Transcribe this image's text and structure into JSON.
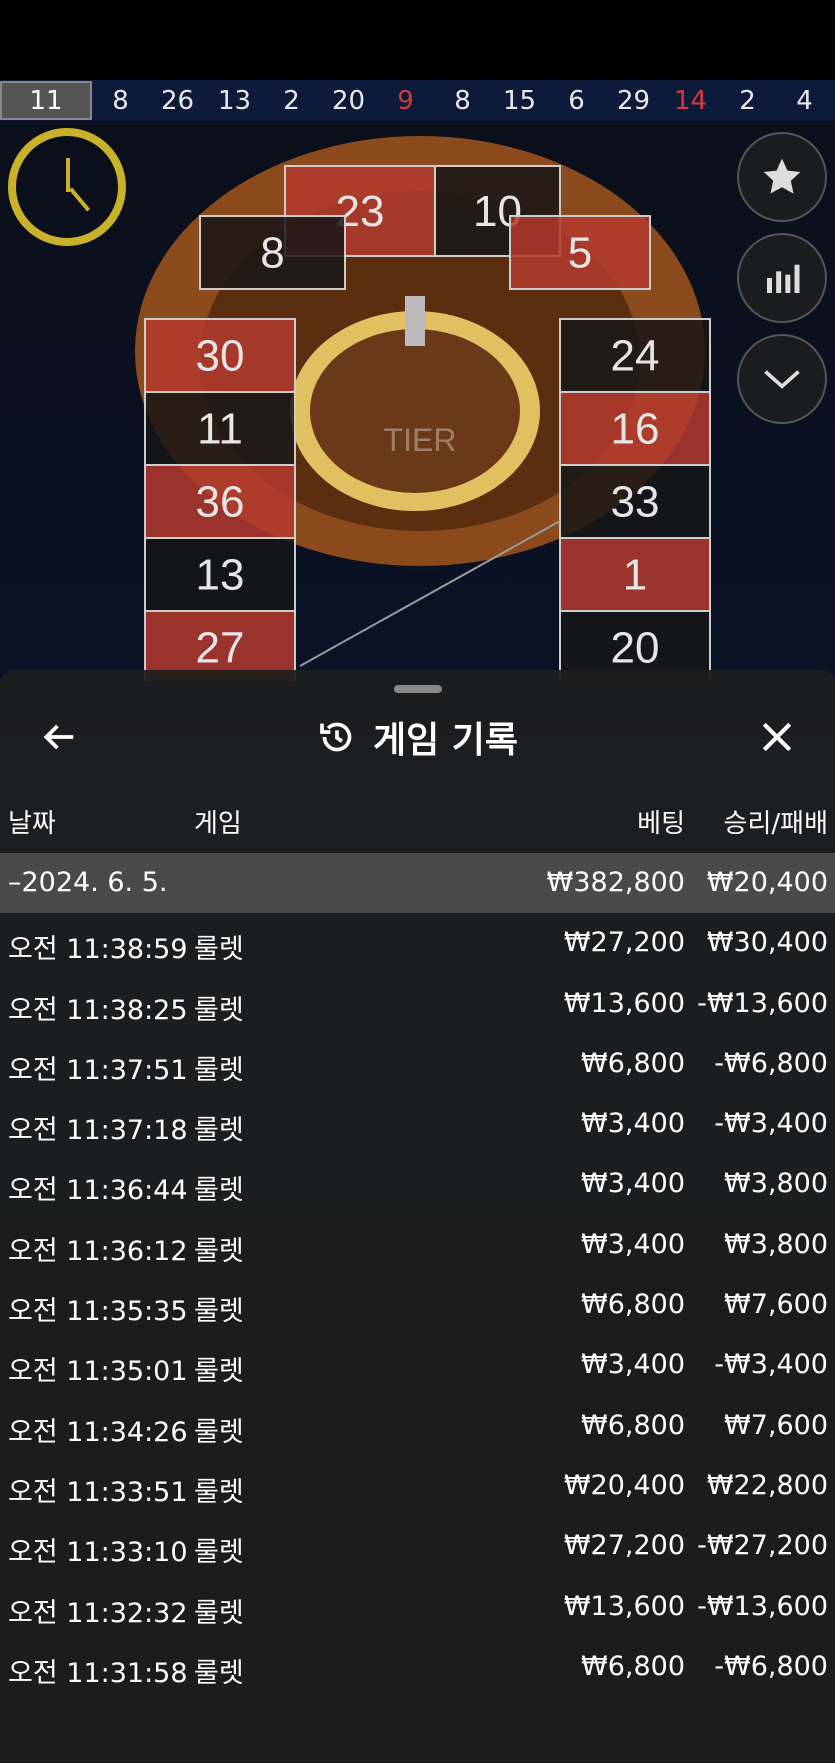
{
  "history_strip": {
    "numbers": [
      {
        "value": "11",
        "color": "grey"
      },
      {
        "value": "8",
        "color": "white"
      },
      {
        "value": "26",
        "color": "white"
      },
      {
        "value": "13",
        "color": "white"
      },
      {
        "value": "2",
        "color": "white"
      },
      {
        "value": "20",
        "color": "white"
      },
      {
        "value": "9",
        "color": "red"
      },
      {
        "value": "8",
        "color": "white"
      },
      {
        "value": "15",
        "color": "white"
      },
      {
        "value": "6",
        "color": "white"
      },
      {
        "value": "29",
        "color": "white"
      },
      {
        "value": "14",
        "color": "red"
      },
      {
        "value": "2",
        "color": "white"
      },
      {
        "value": "4",
        "color": "white"
      }
    ]
  },
  "racetrack": {
    "top": [
      "23",
      "10"
    ],
    "left_col": [
      "8",
      "30",
      "11",
      "36",
      "13",
      "27"
    ],
    "right_col": [
      "5",
      "24",
      "16",
      "33",
      "1",
      "20"
    ],
    "sector_label": "TIER"
  },
  "sheet": {
    "title": "게임 기록",
    "columns": {
      "date": "날짜",
      "game": "게임",
      "bet": "베팅",
      "pl": "승리/패배"
    },
    "summary": {
      "date": "–2024. 6. 5.",
      "bet": "₩382,800",
      "pl": "₩20,400"
    },
    "rows": [
      {
        "time": "오전 11:38:59",
        "game": "룰렛",
        "bet": "₩27,200",
        "pl": "₩30,400"
      },
      {
        "time": "오전 11:38:25",
        "game": "룰렛",
        "bet": "₩13,600",
        "pl": "-₩13,600"
      },
      {
        "time": "오전 11:37:51",
        "game": "룰렛",
        "bet": "₩6,800",
        "pl": "-₩6,800"
      },
      {
        "time": "오전 11:37:18",
        "game": "룰렛",
        "bet": "₩3,400",
        "pl": "-₩3,400"
      },
      {
        "time": "오전 11:36:44",
        "game": "룰렛",
        "bet": "₩3,400",
        "pl": "₩3,800"
      },
      {
        "time": "오전 11:36:12",
        "game": "룰렛",
        "bet": "₩3,400",
        "pl": "₩3,800"
      },
      {
        "time": "오전 11:35:35",
        "game": "룰렛",
        "bet": "₩6,800",
        "pl": "₩7,600"
      },
      {
        "time": "오전 11:35:01",
        "game": "룰렛",
        "bet": "₩3,400",
        "pl": "-₩3,400"
      },
      {
        "time": "오전 11:34:26",
        "game": "룰렛",
        "bet": "₩6,800",
        "pl": "₩7,600"
      },
      {
        "time": "오전 11:33:51",
        "game": "룰렛",
        "bet": "₩20,400",
        "pl": "₩22,800"
      },
      {
        "time": "오전 11:33:10",
        "game": "룰렛",
        "bet": "₩27,200",
        "pl": "-₩27,200"
      },
      {
        "time": "오전 11:32:32",
        "game": "룰렛",
        "bet": "₩13,600",
        "pl": "-₩13,600"
      },
      {
        "time": "오전 11:31:58",
        "game": "룰렛",
        "bet": "₩6,800",
        "pl": "-₩6,800"
      }
    ]
  },
  "icons": {
    "timer": "clock-icon",
    "favorite": "star-icon",
    "stats": "bar-chart-icon",
    "collapse": "chevron-down-icon",
    "back": "arrow-left-icon",
    "close": "close-icon",
    "history": "history-icon"
  },
  "colors": {
    "red": "#b33a2e",
    "black": "#161616",
    "accent": "#c9b22a",
    "sheet": "#1e1e1e"
  }
}
